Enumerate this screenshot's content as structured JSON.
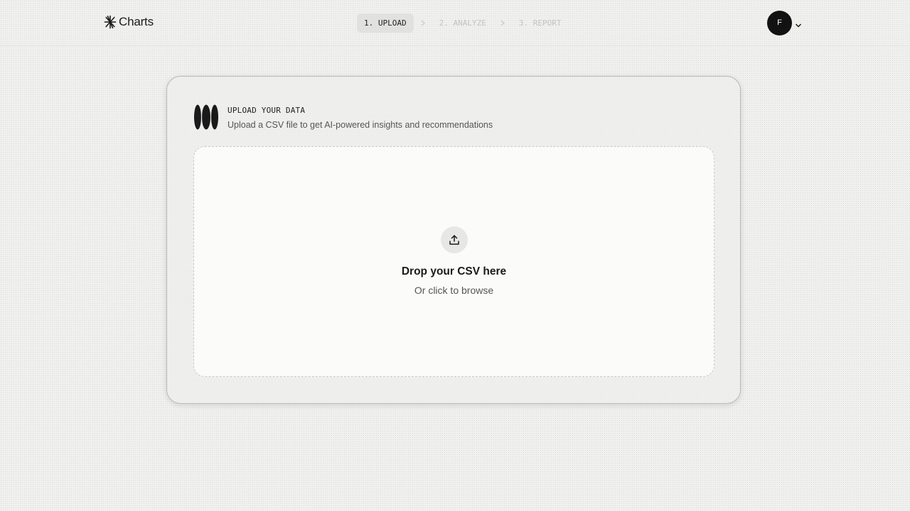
{
  "header": {
    "app_name": "Charts",
    "steps": [
      {
        "label": "1. UPLOAD",
        "state": "active"
      },
      {
        "label": "2. ANALYZE",
        "state": "inactive"
      },
      {
        "label": "3. REPORT",
        "state": "inactive"
      }
    ],
    "user": {
      "initial": "F",
      "menu_icon": "chevron-down-icon"
    },
    "logo_icon": "asterisk-logo-icon"
  },
  "upload_card": {
    "icon": "stacked-ovals-icon",
    "title": "UPLOAD YOUR DATA",
    "subtitle": "Upload a CSV file to get AI-powered insights and recommendations",
    "dropzone": {
      "icon": "upload-icon",
      "title": "Drop your CSV here",
      "subtitle": "Or click to browse"
    }
  },
  "colors": {
    "background": "#f0f0ee",
    "active_step_bg": "#e1e1df",
    "inactive_step_text": "#c2c2c0",
    "avatar_bg": "#121212",
    "dropzone_bg": "#fbfbfa"
  }
}
